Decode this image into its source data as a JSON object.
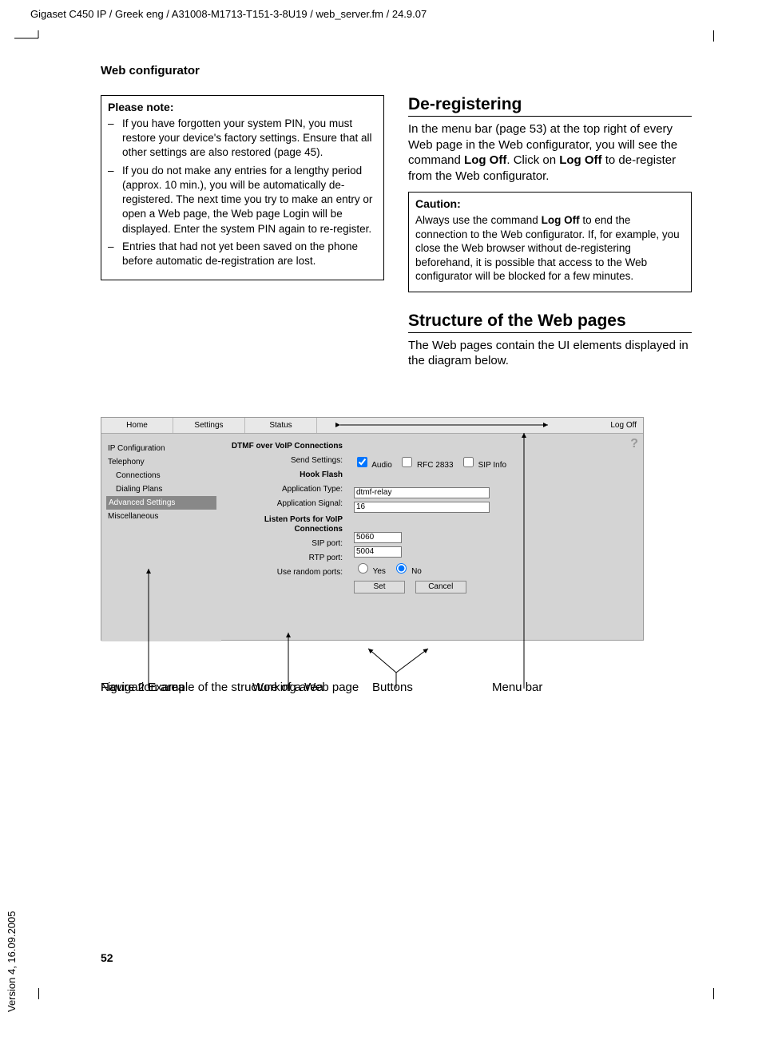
{
  "header": "Gigaset C450 IP / Greek eng / A31008-M1713-T151-3-8U19 / web_server.fm / 24.9.07",
  "version_footer": "Version 4, 16.09.2005",
  "section_header": "Web configurator",
  "page_number": "52",
  "please_note": {
    "title": "Please note:",
    "items": [
      "If you have forgotten your system PIN, you must restore your device's factory settings. Ensure that all other settings are also restored (page 45).",
      "If you do not make any entries for a lengthy period (approx. 10 min.), you will be automatically de-registered. The next time you try to make an entry or open a Web page, the Web page Login will be displayed. Enter the system PIN again to re-register.",
      "Entries that had not yet been saved on the phone before automatic de-registration are lost."
    ]
  },
  "dereg": {
    "heading": "De-registering",
    "body_1": "In the menu bar (page 53) at the top right of every Web page in the Web configurator, you will see the command ",
    "cmd1": "Log Off",
    "body_2": ". Click on ",
    "cmd2": "Log Off",
    "body_3": " to de-register from the Web configurator."
  },
  "caution": {
    "title": "Caution:",
    "body_a": "Always use the command ",
    "cmd": "Log Off",
    "body_b": " to end the connection to the Web configurator. If, for example, you close the Web browser without de-registering beforehand, it is possible that access to the Web configurator will be blocked for a few minutes."
  },
  "structure": {
    "heading": "Structure of the Web pages",
    "body": "The Web pages contain the UI elements displayed in the diagram below."
  },
  "ui": {
    "menu": {
      "home": "Home",
      "settings": "Settings",
      "status": "Status",
      "logoff": "Log Off"
    },
    "nav": {
      "ip": "IP Configuration",
      "tel": "Telephony",
      "conn": "Connections",
      "dial": "Dialing Plans",
      "adv": "Advanced Settings",
      "misc": "Miscellaneous"
    },
    "labels": {
      "grp1": "DTMF over VoIP Connections",
      "send": "Send Settings:",
      "hook": "Hook Flash",
      "apptype": "Application Type:",
      "appsig": "Application Signal:",
      "grp2": "Listen Ports for VoIP Connections",
      "sip": "SIP port:",
      "rtp": "RTP port:",
      "rand": "Use random ports:"
    },
    "fields": {
      "audio": "Audio",
      "rfc": "RFC 2833",
      "sipinfo": "SIP Info",
      "apptype_val": "dtmf-relay",
      "appsig_val": "16",
      "sip_val": "5060",
      "rtp_val": "5004",
      "yes": "Yes",
      "no": "No",
      "set": "Set",
      "cancel": "Cancel"
    },
    "help": "?"
  },
  "callouts": {
    "nav": "Navigation area",
    "work": "Working area",
    "buttons": "Buttons",
    "menubar": "Menu bar"
  },
  "figure_caption": "Figure 2   Example of the structure of a Web page"
}
